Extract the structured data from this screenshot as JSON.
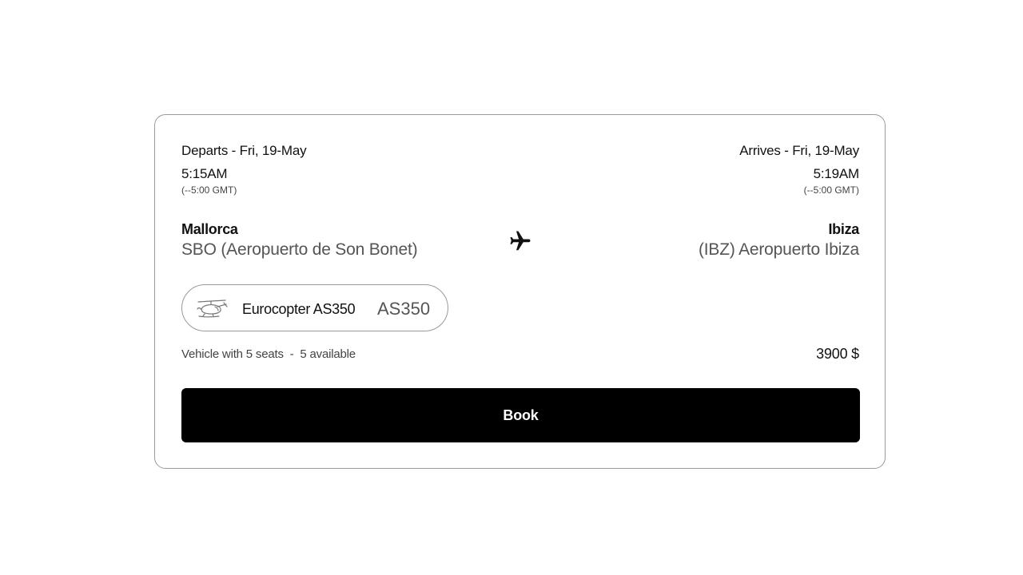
{
  "departure": {
    "date_label": "Departs - Fri, 19-May",
    "time": "5:15AM",
    "timezone": "(--5:00 GMT)",
    "city": "Mallorca",
    "airport": "SBO (Aeropuerto de Son Bonet)"
  },
  "arrival": {
    "date_label": "Arrives - Fri, 19-May",
    "time": "5:19AM",
    "timezone": "(--5:00 GMT)",
    "city": "Ibiza",
    "airport": "(IBZ) Aeropuerto Ibiza"
  },
  "route_icon": "airplane-icon",
  "vehicle": {
    "icon": "helicopter-icon",
    "name": "Eurocopter AS350",
    "code": "AS350",
    "seats_text": "Vehicle with 5 seats  -  5 available"
  },
  "price": "3900 $",
  "book_label": "Book",
  "colors": {
    "button_bg": "#000000",
    "button_text": "#ffffff",
    "border": "#9a9a9a",
    "muted_text": "#555555"
  }
}
